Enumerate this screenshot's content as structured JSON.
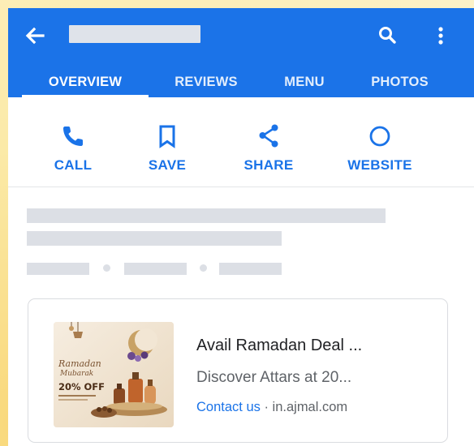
{
  "header": {
    "title": "",
    "back_icon": "arrow-back-icon",
    "search_icon": "search-icon",
    "more_icon": "more-vert-icon",
    "color": "#1b73e8"
  },
  "tabs": [
    {
      "label": "OVERVIEW",
      "selected": true
    },
    {
      "label": "REVIEWS",
      "selected": false
    },
    {
      "label": "MENU",
      "selected": false
    },
    {
      "label": "PHOTOS",
      "selected": false
    }
  ],
  "actions": [
    {
      "label": "CALL",
      "icon": "phone-icon"
    },
    {
      "label": "SAVE",
      "icon": "bookmark-icon"
    },
    {
      "label": "SHARE",
      "icon": "share-icon"
    },
    {
      "label": "WEBSITE",
      "icon": "website-circle-icon"
    }
  ],
  "ad": {
    "title": "Avail Ramadan Deal ...",
    "description": "Discover Attars at 20...",
    "cta": "Contact us",
    "separator": " · ",
    "domain": "in.ajmal.com",
    "image": {
      "script_line1": "Ramadan",
      "script_line2": "Mubarak",
      "offer": "20% OFF"
    }
  },
  "colors": {
    "accent": "#1a73e8",
    "placeholder": "#dcdfe5"
  }
}
